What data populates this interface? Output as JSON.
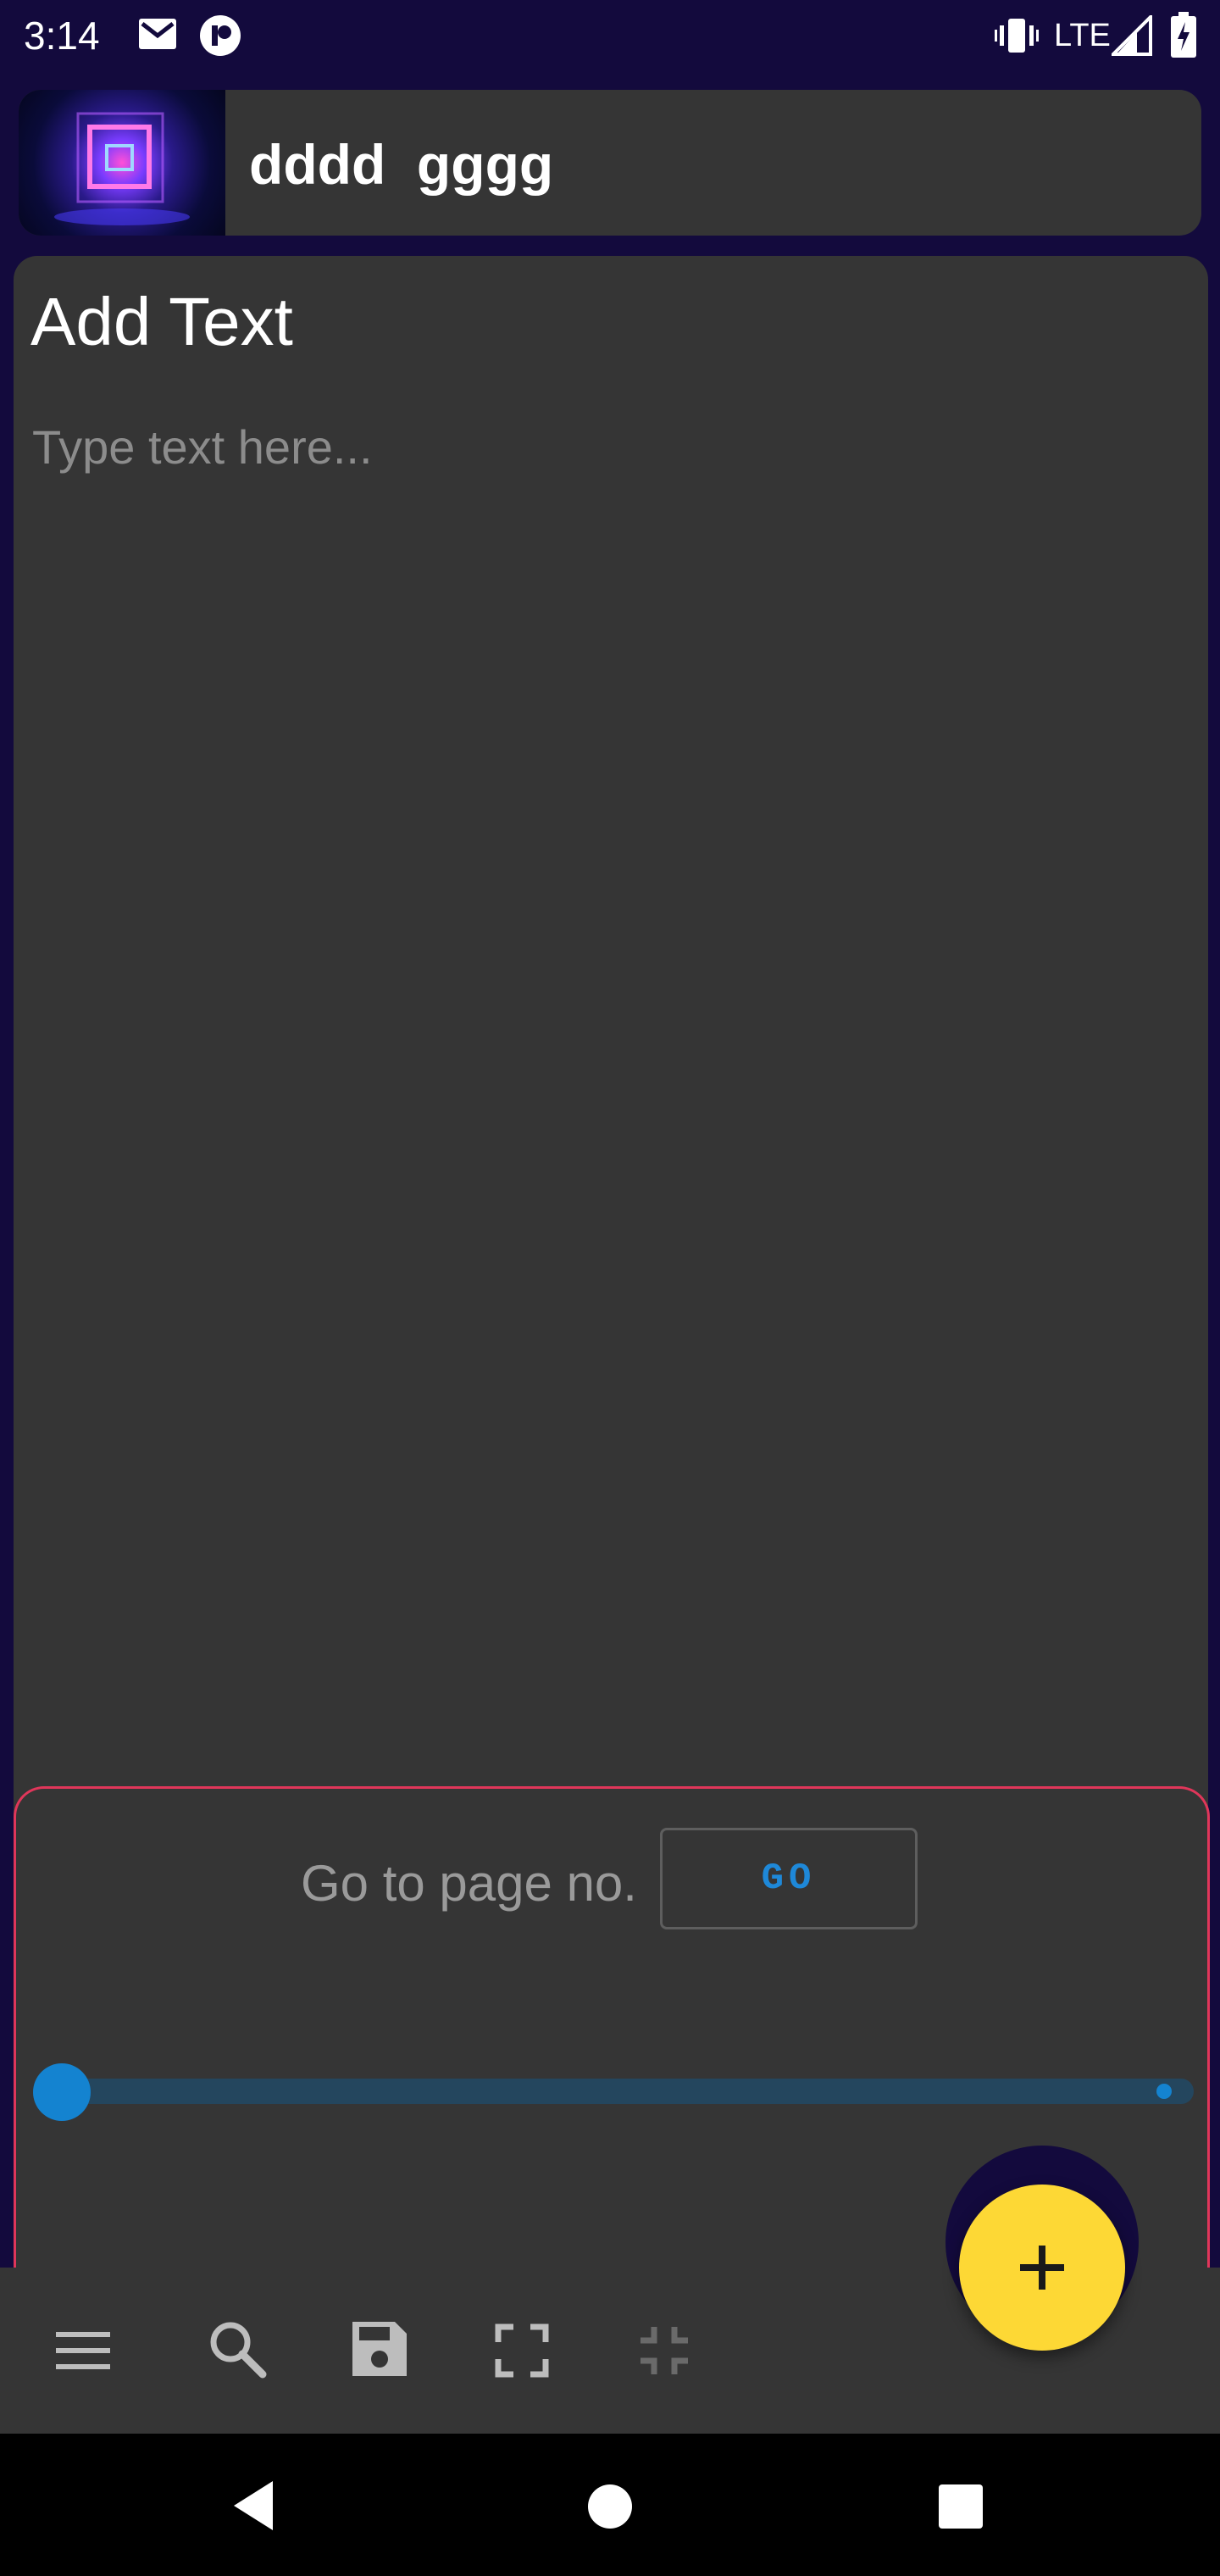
{
  "status_bar": {
    "time": "3:14",
    "network": "LTE",
    "icons": [
      "gmail-icon",
      "app-notification-icon",
      "vibrate-icon",
      "signal-icon",
      "battery-icon"
    ]
  },
  "header": {
    "title": "dddd  gggg",
    "thumbnail": "cosmic-neon-square-image"
  },
  "editor": {
    "title": "Add Text",
    "placeholder": "Type text here...",
    "value": ""
  },
  "page_nav": {
    "label": "Go to page no.",
    "go_label": "GO",
    "slider_position": 0
  },
  "bottom_bar": {
    "icons": [
      "menu-icon",
      "search-icon",
      "save-icon",
      "fullscreen-icon",
      "fullscreen-exit-icon"
    ],
    "fab_icon": "add-icon"
  },
  "colors": {
    "background": "#130a3d",
    "card": "#353535",
    "accent_blue": "#1483d0",
    "fab_yellow": "#fdd835",
    "panel_border": "#e0365a"
  }
}
